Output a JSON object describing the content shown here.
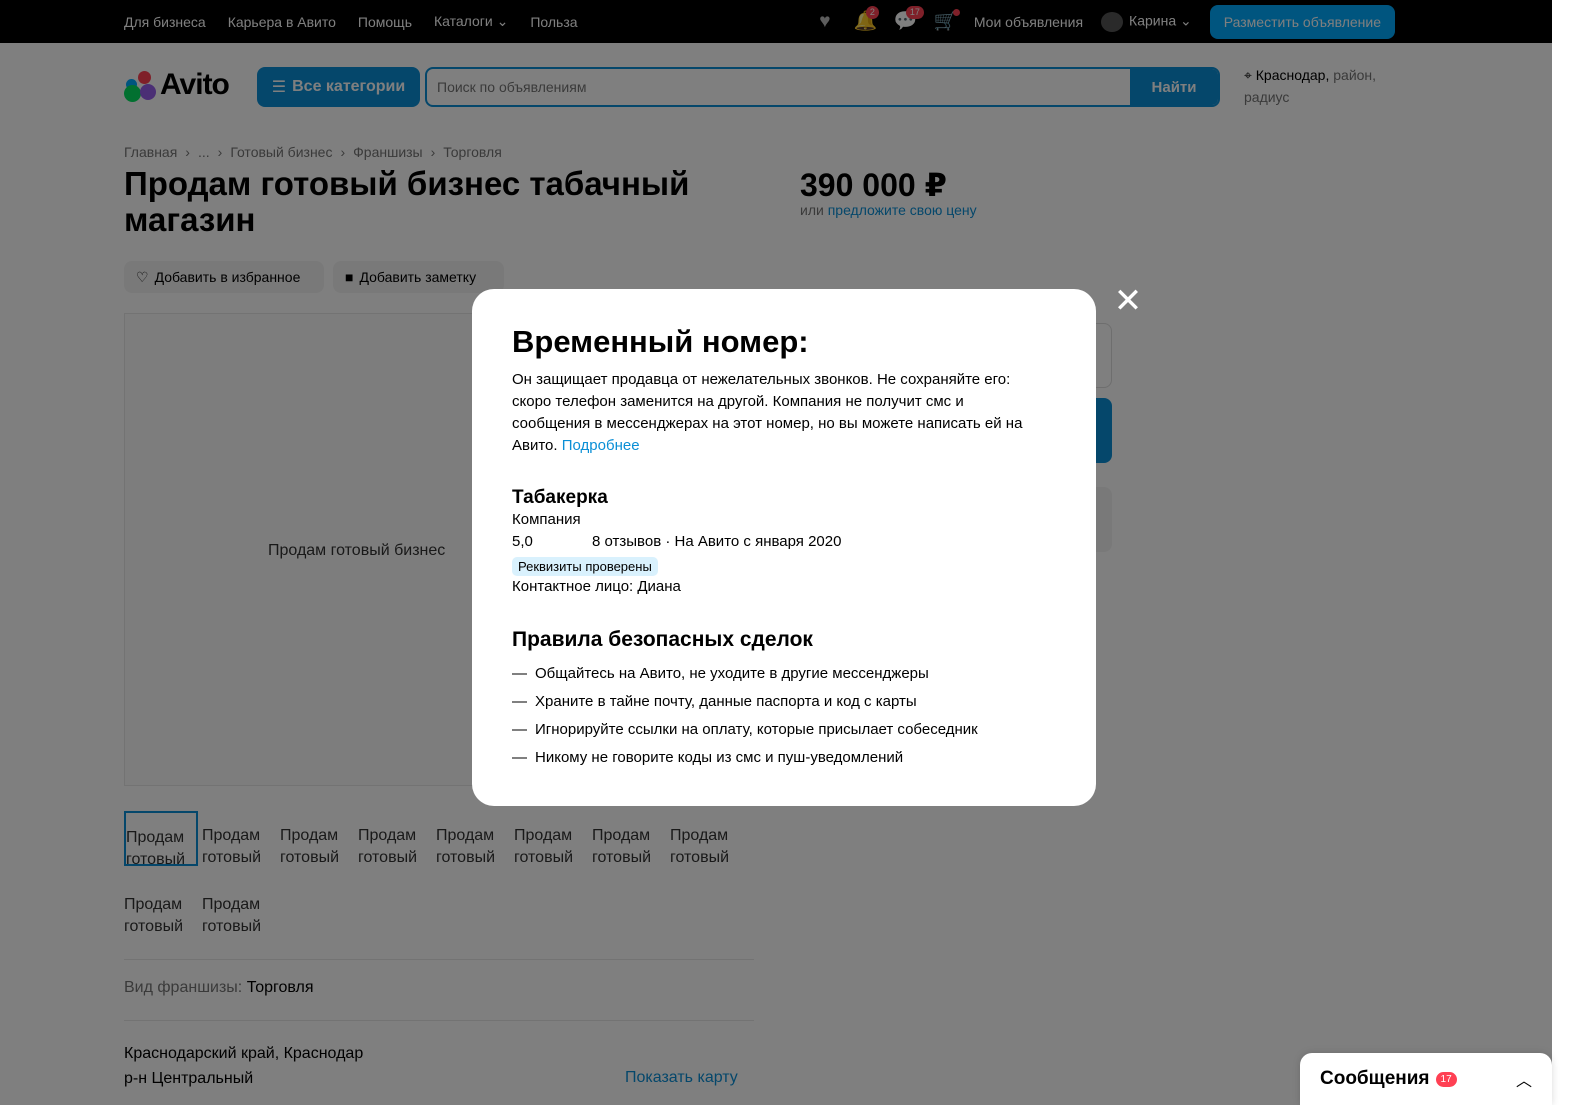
{
  "topnav": {
    "links": [
      "Для бизнеса",
      "Карьера в Авито",
      "Помощь",
      "Каталоги",
      "Польза"
    ],
    "catalog_chevron": "⌄"
  },
  "topright": {
    "notifications_count": "2",
    "messages_count": "17",
    "my_ads": "Мои объявления",
    "user_name": "Карина",
    "post_ad": "Разместить объявление"
  },
  "header": {
    "logo_text": "Avito",
    "categories_label": "Все категории",
    "search_placeholder": "Поиск по объявлениям",
    "search_button": "Найти",
    "location_city": "Краснодар,",
    "location_hint": "район, радиус"
  },
  "breadcrumbs": [
    "Главная",
    "...",
    "Готовый бизнес",
    "Франшизы",
    "Торговля"
  ],
  "listing": {
    "title": "Продам готовый бизнес табачный магазин",
    "price": "390 000 ₽",
    "price_or": "или",
    "price_offer": "предложите свою цену",
    "add_favorite": "Добавить в избранное",
    "add_note": "Добавить заметку",
    "gallery_alt": "Продам готовый бизнес",
    "thumb_alt": "Продам готовый",
    "franchise_label": "Вид франшизы:",
    "franchise_value": "Торговля",
    "address_line1": "Краснодарский край, Краснодар",
    "address_line2": "р-н Центральный",
    "show_map": "Показать карту"
  },
  "modal": {
    "title": "Временный номер:",
    "text": "Он защищает продавца от нежелательных звонков. Не сохраняйте его: скоро телефон заменится на другой. Компания не получит смс и сообщения в мессенджерах на этот номер, но вы можете написать ей на Авито.",
    "more_link": "Подробнее",
    "seller_name": "Табакерка",
    "seller_type": "Компания",
    "rating": "5,0",
    "reviews": "8 отзывов · На Авито с января 2020",
    "verified_badge": "Реквизиты проверены",
    "contact_person": "Контактное лицо: Диана",
    "rules_title": "Правила безопасных сделок",
    "rules": [
      "Общайтесь на Авито, не уходите в другие мессенджеры",
      "Храните в тайне почту, данные паспорта и код с карты",
      "Игнорируйте ссылки на оплату, которые присылает собеседник",
      "Никому не говорите коды из смс и пуш-уведомлений"
    ],
    "rule_dash": "—",
    "close_glyph": "✕"
  },
  "messages_dock": {
    "label": "Сообщения",
    "count": "17"
  },
  "colors": {
    "accent": "#0a8fd6",
    "brand_blue": "#00aaff",
    "badge_red": "#ff4053"
  }
}
